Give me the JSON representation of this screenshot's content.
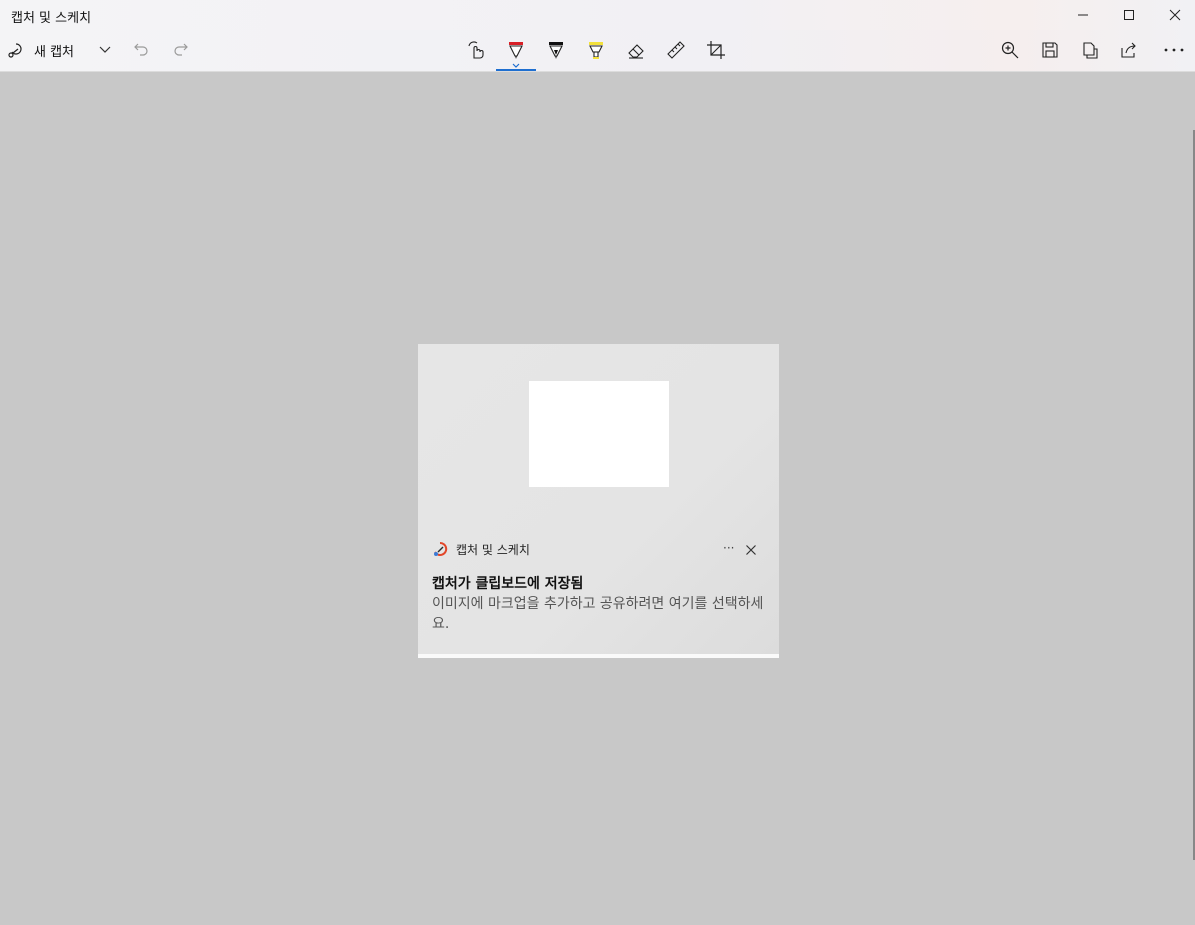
{
  "window": {
    "title": "캡처 및 스케치",
    "minimize_icon": "minimize-icon",
    "maximize_icon": "maximize-icon",
    "close_icon": "close-icon"
  },
  "toolbar": {
    "new_capture_label": "새 캡처",
    "left_icons": [
      "snip-icon",
      "chevron-down-icon",
      "undo-icon",
      "redo-icon"
    ],
    "center_tools": [
      "touch-writing-icon",
      "ballpoint-pen-icon",
      "pencil-icon",
      "highlighter-icon",
      "eraser-icon",
      "ruler-icon",
      "crop-icon"
    ],
    "active_tool": "ballpoint-pen",
    "right_icons": [
      "zoom-in-icon",
      "save-icon",
      "copy-icon",
      "share-icon",
      "more-icon"
    ],
    "pen_color": "#d81f26",
    "highlighter_color": "#f3e13b",
    "accent_color": "#1f6fd0"
  },
  "notification": {
    "app_name": "캡처 및 스케치",
    "more_label": "···",
    "title": "캡처가 클립보드에 저장됨",
    "body": "이미지에 마크업을 추가하고 공유하려면 여기를 선택하세요."
  }
}
